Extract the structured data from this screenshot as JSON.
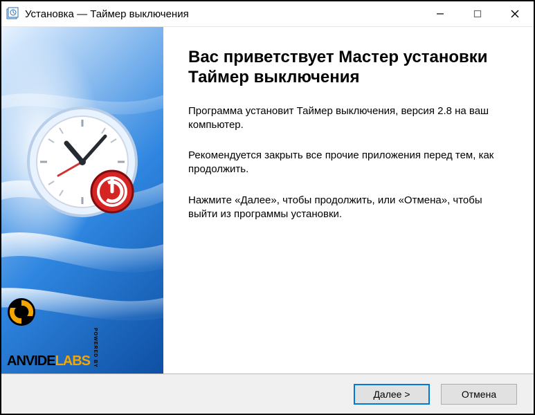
{
  "titlebar": {
    "title": "Установка — Таймер выключения"
  },
  "content": {
    "heading": "Вас приветствует Мастер установки Таймер выключения",
    "para1": "Программа установит Таймер выключения, версия 2.8 на ваш компьютер.",
    "para2": "Рекомендуется закрыть все прочие приложения перед тем, как продолжить.",
    "para3": "Нажмите «Далее», чтобы продолжить, или «Отмена», чтобы выйти из программы установки."
  },
  "brand": {
    "line1_a": "ANVIDE",
    "line1_b": "LABS",
    "powered": "POWERED BY"
  },
  "footer": {
    "next_label": "Далее >",
    "cancel_label": "Отмена"
  }
}
